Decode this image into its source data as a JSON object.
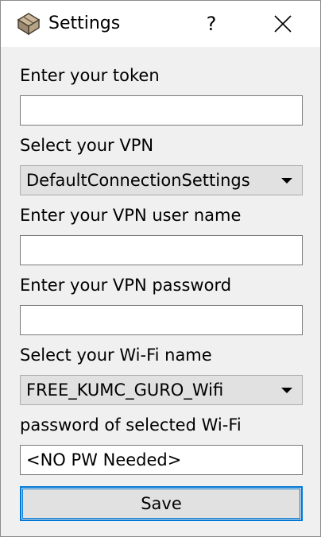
{
  "window": {
    "title": "Settings",
    "help_label": "?"
  },
  "form": {
    "token_label": "Enter your token",
    "token_value": "",
    "vpn_label": "Select your VPN",
    "vpn_selected": "DefaultConnectionSettings",
    "vpn_user_label": "Enter your VPN user name",
    "vpn_user_value": "",
    "vpn_password_label": "Enter your VPN password",
    "vpn_password_value": "",
    "wifi_label": "Select your Wi-Fi name",
    "wifi_selected": "FREE_KUMC_GURO_Wifi",
    "wifi_password_label": "password of selected Wi-Fi",
    "wifi_password_value": "<NO PW Needed>",
    "save_label": "Save"
  },
  "icons": {
    "app": "package-icon",
    "close": "close-icon",
    "dropdown": "chevron-down-icon"
  },
  "colors": {
    "focus_border": "#0078d7",
    "window_bg": "#f0f0f0",
    "titlebar_bg": "#ffffff"
  }
}
